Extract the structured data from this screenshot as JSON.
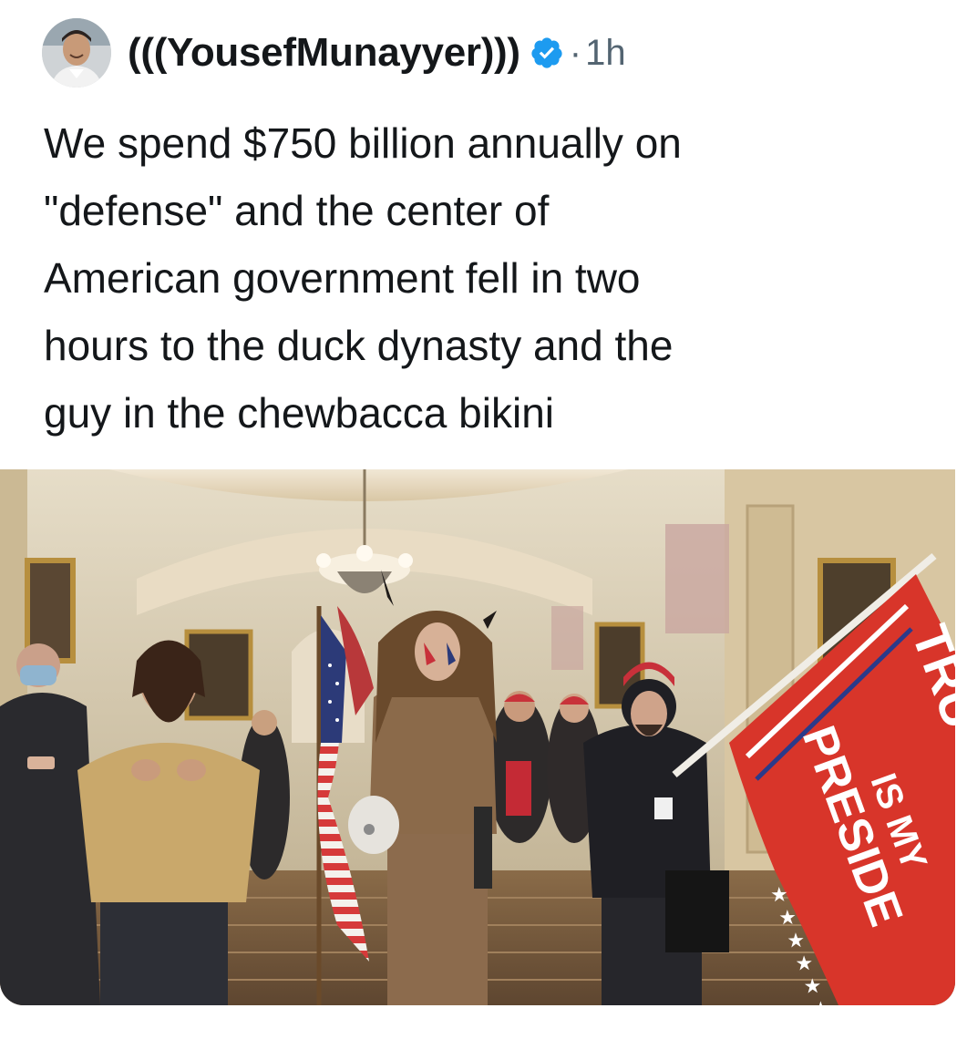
{
  "author": {
    "display_name": "(((YousefMunayyer)))",
    "verified_icon": "verified-badge-icon",
    "separator": "·",
    "timestamp": "1h"
  },
  "tweet": {
    "text": "We spend $750 billion annually on\n\"defense\" and the center of\nAmerican government fell in two\nhours to the duck dynasty and the\nguy in the chewbacca bikini"
  },
  "photo": {
    "flag_text_line1": "TRU",
    "flag_text_line2": "IS MY",
    "flag_text_line3": "PRESIDE"
  },
  "colors": {
    "verified_blue": "#1d9bf0",
    "text": "#14171a",
    "muted": "#536471",
    "flag_red": "#d8352a"
  }
}
